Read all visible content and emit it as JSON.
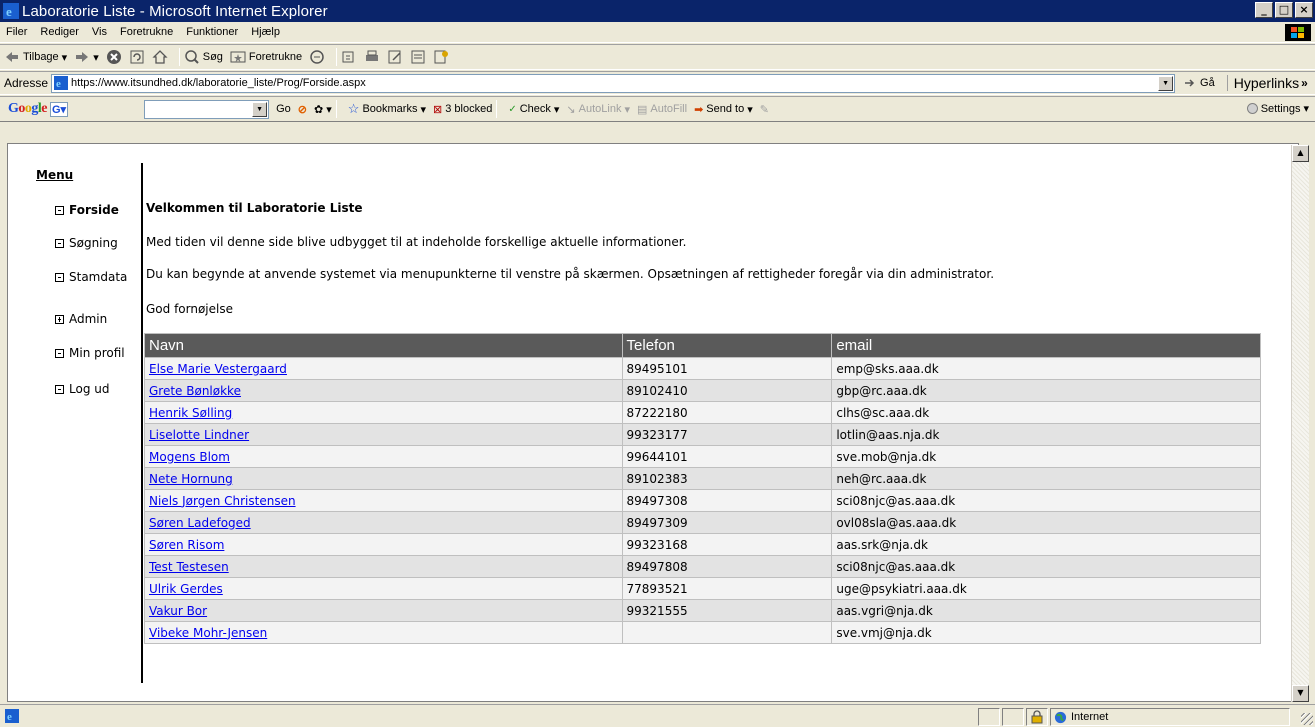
{
  "window": {
    "title": "Laboratorie Liste - Microsoft Internet Explorer",
    "buttons": [
      "_",
      "□",
      "×"
    ]
  },
  "menubar": {
    "items": [
      "Filer",
      "Rediger",
      "Vis",
      "Foretrukne",
      "Funktioner",
      "Hjælp"
    ]
  },
  "toolbar": {
    "back_label": "Tilbage",
    "search_label": "Søg",
    "favorites_label": "Foretrukne"
  },
  "address": {
    "label": "Adresse",
    "url": "https://www.itsundhed.dk/laboratorie_liste/Prog/Forside.aspx",
    "go_label": "Gå",
    "links_label": "Hyperlinks"
  },
  "google_toolbar": {
    "logo": "Google",
    "go_label": "Go",
    "bookmarks_label": "Bookmarks",
    "blocked_label": "3 blocked",
    "check_label": "Check",
    "autolink_label": "AutoLink",
    "autofill_label": "AutoFill",
    "sendto_label": "Send to",
    "settings_label": "Settings"
  },
  "nav": {
    "title": "Menu",
    "items": [
      {
        "label": "Forside",
        "active": true,
        "plus": false
      },
      {
        "label": "Søgning",
        "active": false,
        "plus": false
      },
      {
        "label": "Stamdata",
        "active": false,
        "plus": false
      },
      {
        "label": "Admin",
        "active": false,
        "plus": true
      },
      {
        "label": "Min profil",
        "active": false,
        "plus": false
      },
      {
        "label": "Log ud",
        "active": false,
        "plus": false
      }
    ]
  },
  "main": {
    "heading": "Velkommen til Laboratorie Liste",
    "para1": "Med tiden vil denne side blive udbygget til at indeholde forskellige aktuelle informationer.",
    "para2": "Du kan begynde at anvende systemet via menupunkterne til venstre på skærmen. Opsætningen af rettigheder foregår via din administrator.",
    "para3": "God fornøjelse"
  },
  "table": {
    "columns": [
      "Navn",
      "Telefon",
      "email"
    ],
    "rows": [
      {
        "navn": "Else Marie Vestergaard",
        "telefon": "89495101",
        "email": "emp@sks.aaa.dk"
      },
      {
        "navn": "Grete Bønløkke",
        "telefon": "89102410",
        "email": "gbp@rc.aaa.dk"
      },
      {
        "navn": "Henrik Sølling",
        "telefon": "87222180",
        "email": "clhs@sc.aaa.dk"
      },
      {
        "navn": "Liselotte Lindner",
        "telefon": "99323177",
        "email": "lotlin@aas.nja.dk"
      },
      {
        "navn": "Mogens Blom",
        "telefon": "99644101",
        "email": "sve.mob@nja.dk"
      },
      {
        "navn": "Nete Hornung",
        "telefon": "89102383",
        "email": "neh@rc.aaa.dk"
      },
      {
        "navn": "Niels Jørgen Christensen",
        "telefon": "89497308",
        "email": "sci08njc@as.aaa.dk"
      },
      {
        "navn": "Søren Ladefoged",
        "telefon": "89497309",
        "email": "ovl08sla@as.aaa.dk"
      },
      {
        "navn": "Søren Risom",
        "telefon": "99323168",
        "email": "aas.srk@nja.dk"
      },
      {
        "navn": "Test Testesen",
        "telefon": "89497808",
        "email": "sci08njc@as.aaa.dk"
      },
      {
        "navn": "Ulrik Gerdes",
        "telefon": "77893521",
        "email": "uge@psykiatri.aaa.dk"
      },
      {
        "navn": "Vakur Bor",
        "telefon": "99321555",
        "email": "aas.vgri@nja.dk"
      },
      {
        "navn": "Vibeke Mohr-Jensen",
        "telefon": "",
        "email": "sve.vmj@nja.dk"
      }
    ]
  },
  "statusbar": {
    "zone": "Internet"
  }
}
